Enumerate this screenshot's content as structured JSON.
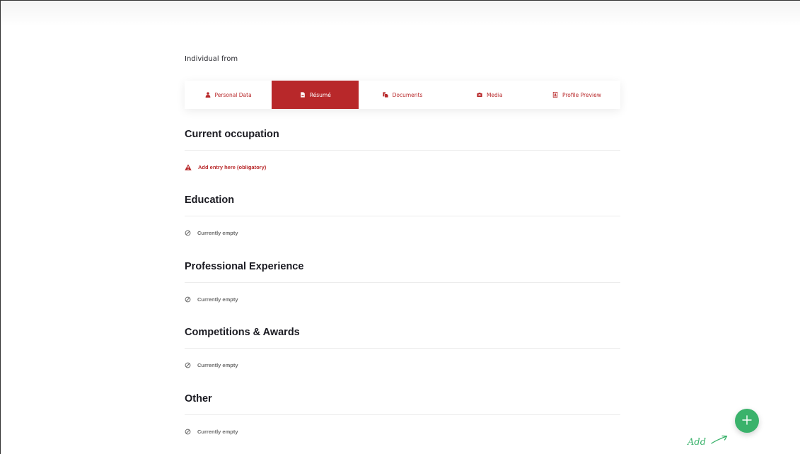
{
  "page": {
    "title": "Individual from"
  },
  "tabs": [
    {
      "label": "Personal Data",
      "icon": "person-icon",
      "active": false
    },
    {
      "label": "Résumé",
      "icon": "file-icon",
      "active": true
    },
    {
      "label": "Documents",
      "icon": "documents-icon",
      "active": false
    },
    {
      "label": "Media",
      "icon": "camera-icon",
      "active": false
    },
    {
      "label": "Profile Preview",
      "icon": "profile-card-icon",
      "active": false
    }
  ],
  "sections": [
    {
      "title": "Current occupation",
      "status": "warning",
      "message": "Add entry here (obligatory)",
      "icon": "warning-triangle-icon"
    },
    {
      "title": "Education",
      "status": "empty",
      "message": "Currently empty",
      "icon": "empty-circle-icon"
    },
    {
      "title": "Professional Experience",
      "status": "empty",
      "message": "Currently empty",
      "icon": "empty-circle-icon"
    },
    {
      "title": "Competitions & Awards",
      "status": "empty",
      "message": "Currently empty",
      "icon": "empty-circle-icon"
    },
    {
      "title": "Other",
      "status": "empty",
      "message": "Currently empty",
      "icon": "empty-circle-icon"
    }
  ],
  "fab": {
    "hint_label": "Add",
    "icon": "plus-icon"
  },
  "colors": {
    "accent": "#b8282a",
    "success": "#3ab26b",
    "heading": "#1b1b22",
    "muted": "#6a6a6a"
  }
}
